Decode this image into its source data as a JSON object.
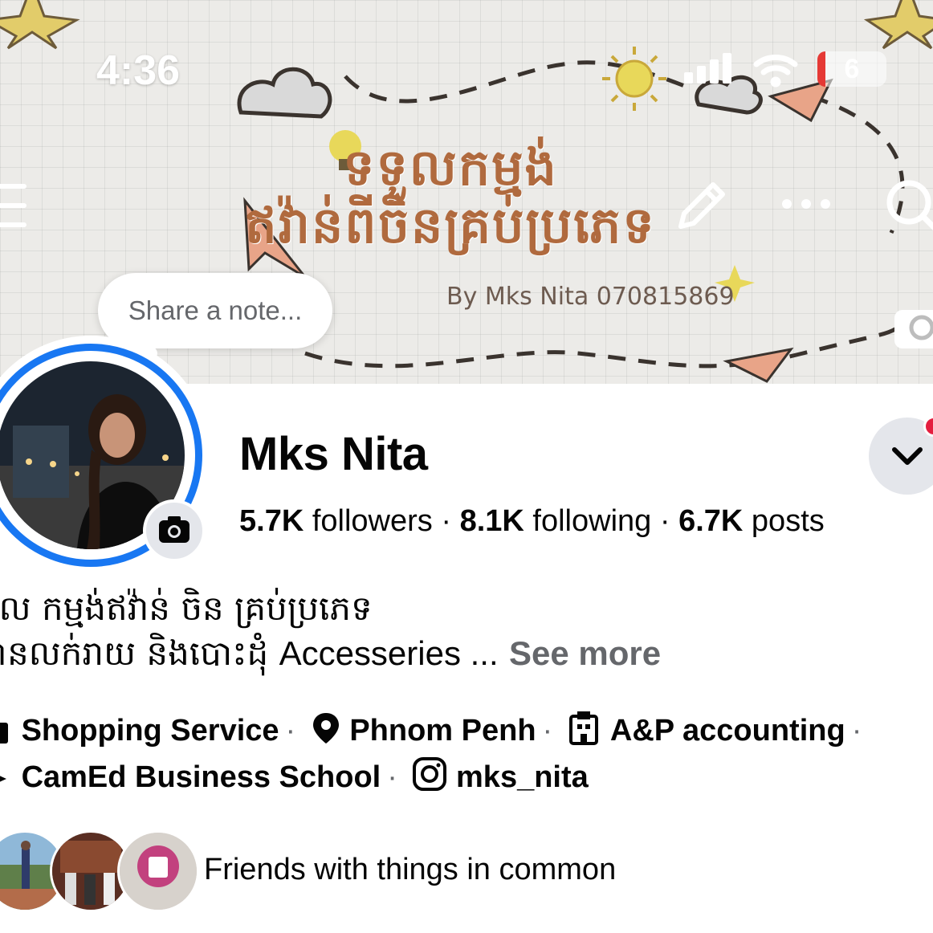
{
  "status_bar": {
    "time": "4:36",
    "battery": "6"
  },
  "cover": {
    "title_line1": "ទទួលកម្មង់",
    "title_line2": "ឥវ៉ាន់ពីចិនគ្រប់ប្រភេទ",
    "byline": "By Mks Nita 070815869"
  },
  "note": {
    "placeholder": "Share a note..."
  },
  "profile": {
    "name": "Mks Nita",
    "followers_count": "5.7K",
    "followers_label": "followers",
    "following_count": "8.1K",
    "following_label": "following",
    "posts_count": "6.7K",
    "posts_label": "posts"
  },
  "bio": {
    "line1": "ទួល កម្មង់ឥវ៉ាន់ ចិន គ្រប់ប្រភេទ",
    "line2_khmer": "ានលក់រាយ និងបោះដុំ",
    "line2_en": "Accesseries ...",
    "see_more": "See more"
  },
  "details": {
    "category": "Shopping Service",
    "location": "Phnom Penh",
    "work": "A&P accounting",
    "education": "CamEd Business School",
    "instagram": "mks_nita",
    "separator": "·"
  },
  "friends": {
    "label": "Friends with things in common"
  },
  "colors": {
    "accent": "#1877f2",
    "text": "#050505",
    "muted": "#65676b",
    "notification": "#e41e3f",
    "cover_text": "#b06a3e"
  },
  "icons": [
    "menu-icon",
    "edit-icon",
    "more-icon",
    "search-icon",
    "camera-icon",
    "chevron-down-icon",
    "location-icon",
    "work-icon",
    "education-icon",
    "instagram-icon",
    "shopping-icon"
  ]
}
